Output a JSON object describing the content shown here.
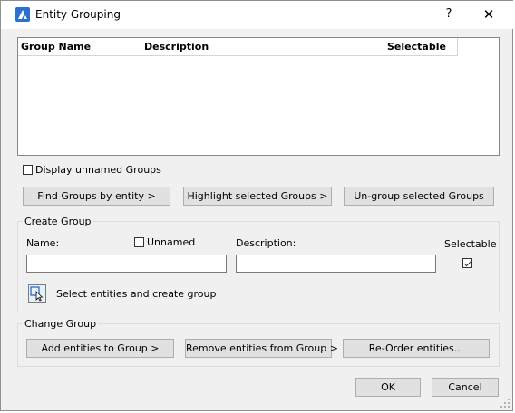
{
  "window": {
    "title": "Entity Grouping",
    "help_label": "?",
    "close_label": "✕",
    "icon": "app-logo-icon"
  },
  "table": {
    "columns": [
      "Group Name",
      "Description",
      "Selectable"
    ],
    "rows": []
  },
  "options": {
    "display_unnamed_label": "Display unnamed Groups",
    "display_unnamed_checked": false
  },
  "actions": {
    "find_groups": "Find Groups by entity >",
    "highlight_groups": "Highlight selected Groups >",
    "ungroup": "Un-group selected Groups"
  },
  "create_group": {
    "title": "Create Group",
    "name_label": "Name:",
    "name_value": "",
    "unnamed_label": "Unnamed",
    "unnamed_checked": false,
    "description_label": "Description:",
    "description_value": "",
    "selectable_label": "Selectable",
    "selectable_checked": true,
    "select_create_label": "Select entities and create group"
  },
  "change_group": {
    "title": "Change Group",
    "add_entities": "Add entities to Group >",
    "remove_entities": "Remove entities from Group >",
    "reorder_entities": "Re-Order entities..."
  },
  "footer": {
    "ok": "OK",
    "cancel": "Cancel"
  }
}
